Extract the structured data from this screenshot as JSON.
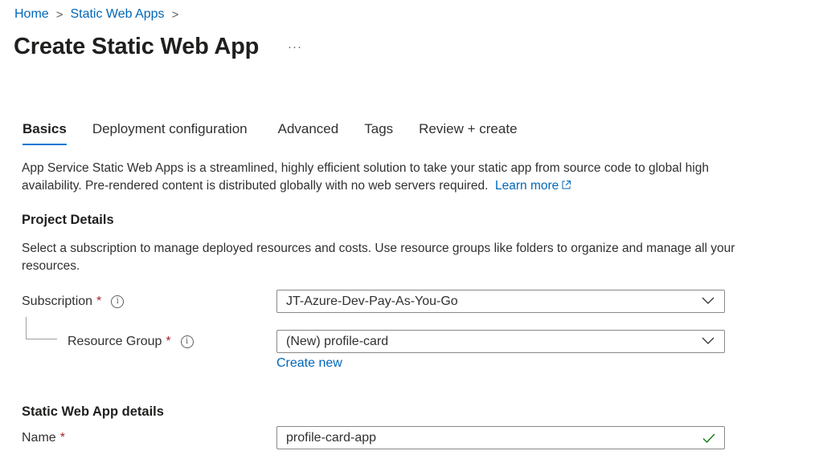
{
  "breadcrumb": {
    "items": [
      "Home",
      "Static Web Apps"
    ],
    "separator": ">"
  },
  "page": {
    "title": "Create Static Web App",
    "more_label": "···"
  },
  "tabs": [
    {
      "label": "Basics",
      "active": true
    },
    {
      "label": "Deployment configuration",
      "active": false
    },
    {
      "label": "Advanced",
      "active": false
    },
    {
      "label": "Tags",
      "active": false
    },
    {
      "label": "Review + create",
      "active": false
    }
  ],
  "intro": {
    "text": "App Service Static Web Apps is a streamlined, highly efficient solution to take your static app from source code to global high availability. Pre-rendered content is distributed globally with no web servers required.",
    "learn_more": "Learn more"
  },
  "project_details": {
    "heading": "Project Details",
    "description": "Select a subscription to manage deployed resources and costs. Use resource groups like folders to organize and manage all your resources.",
    "subscription": {
      "label": "Subscription",
      "required": "*",
      "value": "JT-Azure-Dev-Pay-As-You-Go"
    },
    "resource_group": {
      "label": "Resource Group",
      "required": "*",
      "value": "(New) profile-card",
      "create_new": "Create new"
    }
  },
  "app_details": {
    "heading": "Static Web App details",
    "name": {
      "label": "Name",
      "required": "*",
      "value": "profile-card-app"
    }
  },
  "colors": {
    "accent": "#0078d4",
    "link": "#0067b8",
    "required": "#a4262c",
    "valid": "#107c10"
  }
}
